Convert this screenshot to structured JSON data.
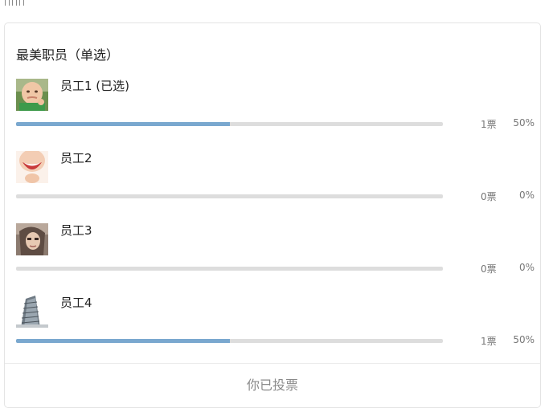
{
  "poll": {
    "title": "最美职员（单选）",
    "status": "你已投票",
    "bar_fill_color": "#7aa8cf",
    "bar_track_color": "#dddddd",
    "options": [
      {
        "label": "员工1 (已选)",
        "votes": "1票",
        "percent": "50%",
        "fill": 0.5,
        "thumb": "baby-photo"
      },
      {
        "label": "员工2",
        "votes": "0票",
        "percent": "0%",
        "fill": 0,
        "thumb": "smile-photo"
      },
      {
        "label": "员工3",
        "votes": "0票",
        "percent": "0%",
        "fill": 0,
        "thumb": "portrait-photo"
      },
      {
        "label": "员工4",
        "votes": "1票",
        "percent": "50%",
        "fill": 0.5,
        "thumb": "building-photo"
      }
    ]
  }
}
